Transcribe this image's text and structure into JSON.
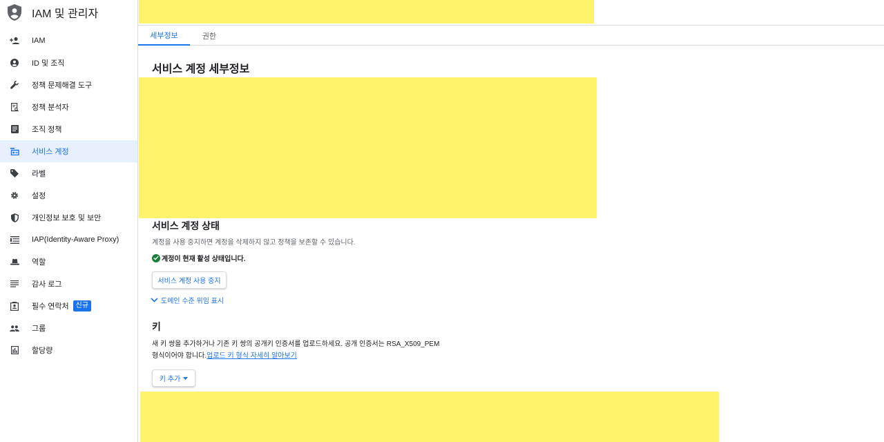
{
  "app": {
    "title": "IAM 및 관리자",
    "logo_icon": "shield-person-icon"
  },
  "sidebar": {
    "items": [
      {
        "label": "IAM",
        "icon": "person-add-icon"
      },
      {
        "label": "ID 및 조직",
        "icon": "account-circle-icon"
      },
      {
        "label": "정책 문제해결 도구",
        "icon": "wrench-icon"
      },
      {
        "label": "정책 분석자",
        "icon": "policy-search-icon"
      },
      {
        "label": "조직 정책",
        "icon": "document-list-icon"
      },
      {
        "label": "서비스 계정",
        "icon": "service-account-icon",
        "active": true
      },
      {
        "label": "라벨",
        "icon": "tag-icon"
      },
      {
        "label": "설정",
        "icon": "gear-icon"
      },
      {
        "label": "개인정보 보호 및 보안",
        "icon": "shield-icon"
      },
      {
        "label": "IAP(Identity-Aware Proxy)",
        "icon": "iap-icon"
      },
      {
        "label": "역할",
        "icon": "hat-icon"
      },
      {
        "label": "감사 로그",
        "icon": "list-icon"
      },
      {
        "label": "필수 연락처",
        "icon": "contact-card-icon",
        "badge": "신규"
      },
      {
        "label": "그룹",
        "icon": "group-icon"
      },
      {
        "label": "할당량",
        "icon": "quota-icon"
      }
    ]
  },
  "tabs": [
    {
      "label": "세부정보",
      "active": true
    },
    {
      "label": "권한",
      "active": false
    }
  ],
  "details": {
    "title": "서비스 계정 세부정보"
  },
  "status_section": {
    "title": "서비스 계정 상태",
    "description": "계정을 사용 중지하면 계정을 삭제하지 않고 정책을 보존할 수 있습니다.",
    "status_text": "계정이 현재 활성 상태입니다.",
    "disable_button": "서비스 계정 사용 중지",
    "delegation_toggle": "도메인 수준 위임 표시"
  },
  "keys_section": {
    "title": "키",
    "description_line1": "새 키 쌍을 추가하거나 기존 키 쌍의 공개키 인증서를 업로드하세요. 공개 인증서는 RSA_X509_PEM",
    "description_line2": "형식이어야 합니다.",
    "learn_more_link": "업로드 키 형식 자세히 알아보기",
    "add_key_button": "키 추가"
  },
  "colors": {
    "accent": "#1a73e8",
    "redaction": "#fff36c",
    "success": "#188038",
    "active_bg": "#e8f0fe"
  }
}
